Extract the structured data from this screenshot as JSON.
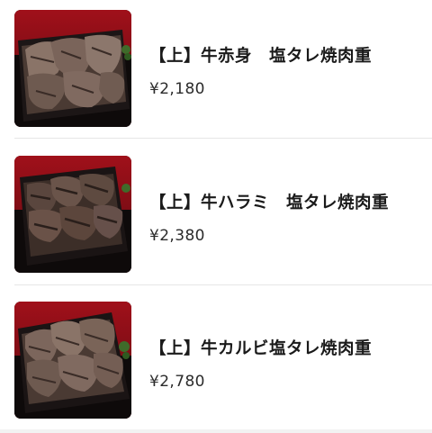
{
  "menu": {
    "items": [
      {
        "title": "【上】牛赤身　塩タレ焼肉重",
        "price": "¥2,180"
      },
      {
        "title": "【上】牛ハラミ　塩タレ焼肉重",
        "price": "¥2,380"
      },
      {
        "title": "【上】牛カルビ塩タレ焼肉重",
        "price": "¥2,780"
      }
    ]
  },
  "colors": {
    "background": "#ffffff",
    "divider": "#e6e6e6",
    "title_text": "#1a1a1a",
    "price_text": "#2b2b2b",
    "photo_backdrop": "#8b0a14"
  }
}
